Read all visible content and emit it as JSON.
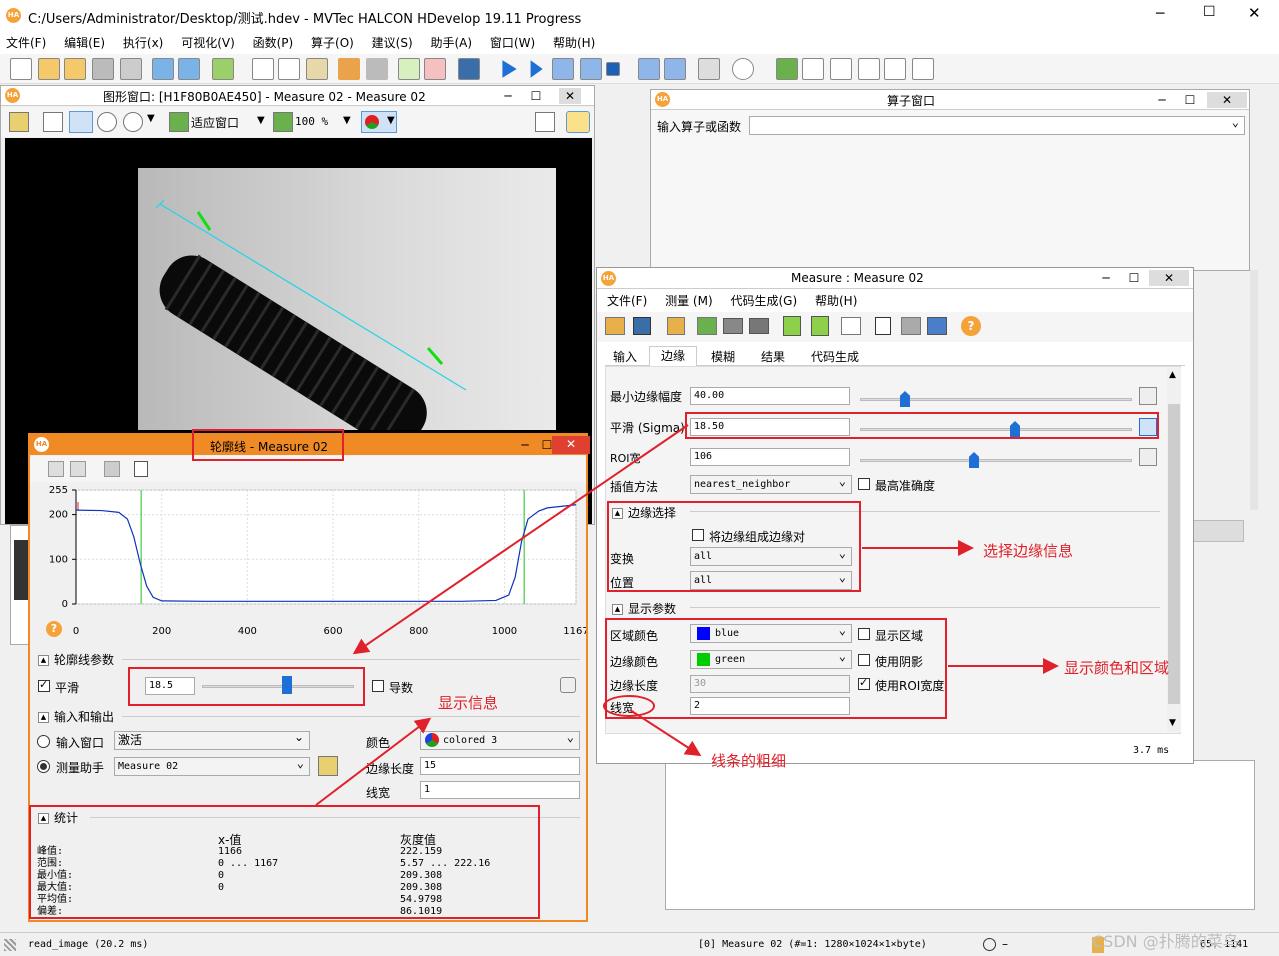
{
  "app": {
    "title": "C:/Users/Administrator/Desktop/测试.hdev - MVTec HALCON HDevelop 19.11 Progress",
    "logo": "HA",
    "menu": [
      "文件(F)",
      "编辑(E)",
      "执行(x)",
      "可视化(V)",
      "函数(P)",
      "算子(O)",
      "建议(S)",
      "助手(A)",
      "窗口(W)",
      "帮助(H)"
    ]
  },
  "graphics_window": {
    "title": "图形窗口: [H1F80B0AE450] - Measure 02 - Measure 02",
    "fit_label": "适应窗口",
    "zoom": "100 %"
  },
  "operator_window": {
    "title": "算子窗口",
    "input_label": "输入算子或函数"
  },
  "measure": {
    "title": "Measure : Measure 02",
    "menu": [
      "文件(F)",
      "测量 (M)",
      "代码生成(G)",
      "帮助(H)"
    ],
    "tabs": [
      "输入",
      "边缘",
      "模糊",
      "结果",
      "代码生成"
    ],
    "active_tab": "边缘",
    "min_edge_label": "最小边缘幅度",
    "min_edge_value": "40.00",
    "smooth_label": "平滑 (Sigma)",
    "smooth_value": "18.50",
    "roi_label": "ROI宽",
    "roi_value": "106",
    "interp_label": "插值方法",
    "interp_value": "nearest_neighbor",
    "max_precision_label": "最高准确度",
    "edge_select_section": "边缘选择",
    "pair_label": "将边缘组成边缘对",
    "transform_label": "变换",
    "transform_value": "all",
    "position_label": "位置",
    "position_value": "all",
    "display_section": "显示参数",
    "region_color_label": "区域颜色",
    "region_color_value": "blue",
    "show_region_label": "显示区域",
    "edge_color_label": "边缘颜色",
    "edge_color_value": "green",
    "use_shadow_label": "使用阴影",
    "edge_length_label": "边缘长度",
    "edge_length_value": "30",
    "use_roi_width_label": "使用ROI宽度",
    "line_width_label": "线宽",
    "line_width_value": "2",
    "time": "3.7 ms"
  },
  "profile": {
    "title": "轮廓线 - Measure 02",
    "profile_params_section": "轮廓线参数",
    "smooth_label": "平滑",
    "smooth_value": "18.5",
    "derivative_label": "导数",
    "io_section": "输入和输出",
    "input_window_label": "输入窗口",
    "input_window_value": "激活",
    "helper_label": "测量助手",
    "helper_value": "Measure 02",
    "color_label": "颜色",
    "color_value": "colored 3",
    "edge_length_label": "边缘长度",
    "edge_length_value": "15",
    "line_width_label": "线宽",
    "line_width_value": "1",
    "stats_section": "统计",
    "stats_header_x": "x-值",
    "stats_header_gray": "灰度值",
    "stats_rows": [
      "峰值:",
      "范围:",
      "最小值:",
      "最大值:",
      "平均值:",
      "偏差:"
    ],
    "stats_x": [
      "1166",
      "0 ... 1167",
      "0",
      "0",
      "",
      ""
    ],
    "stats_gray": [
      "222.159",
      "5.57 ... 222.16",
      "209.308",
      "209.308",
      "54.9798",
      "86.1019"
    ]
  },
  "chart_data": {
    "type": "line",
    "x_ticks": [
      "0",
      "200",
      "400",
      "600",
      "800",
      "1000",
      "1167"
    ],
    "y_ticks": [
      "0",
      "100",
      "200",
      "255"
    ],
    "xlim": [
      0,
      1167
    ],
    "ylim": [
      0,
      255
    ],
    "edges_x": [
      152,
      1046
    ],
    "series": [
      {
        "x": [
          0,
          60,
          100,
          120,
          135,
          150,
          165,
          180,
          200,
          300,
          600,
          900,
          980,
          1010,
          1025,
          1040,
          1055,
          1080,
          1100,
          1167
        ],
        "values": [
          210,
          209,
          205,
          190,
          150,
          90,
          40,
          15,
          7,
          6,
          6,
          6,
          8,
          20,
          60,
          140,
          190,
          208,
          215,
          222
        ]
      }
    ]
  },
  "status": {
    "left": "read_image (20.2 ms)",
    "right": "[0] Measure 02 (#=1: 1280×1024×1×byte)",
    "coords": "65, 1141",
    "watermark": "CSDN @扑腾的菜鸟"
  },
  "annotations": {
    "edge_info": "选择边缘信息",
    "display_color": "显示颜色和区域",
    "line_thickness": "线条的粗细",
    "display_info": "显示信息"
  },
  "colors": {
    "annotation": "#e0202a",
    "profile_frame": "#f08a24",
    "region_blue": "#0000ff",
    "edge_green": "#00cc00",
    "accent": "#1e6fd6"
  }
}
